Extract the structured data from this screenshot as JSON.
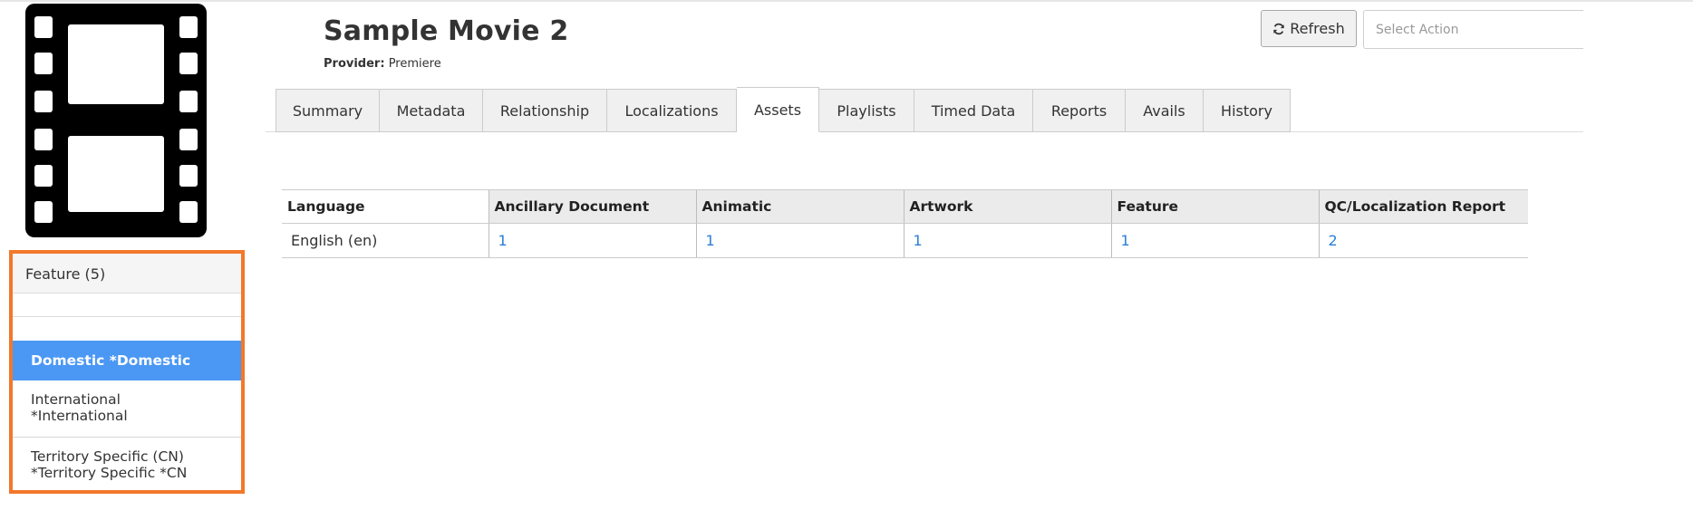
{
  "header": {
    "title": "Sample Movie 2",
    "provider_label": "Provider:",
    "provider_value": "Premiere"
  },
  "toolbar": {
    "refresh_label": "Refresh",
    "select_action_placeholder": "Select Action"
  },
  "tabs": [
    {
      "label": "Summary",
      "active": false
    },
    {
      "label": "Metadata",
      "active": false
    },
    {
      "label": "Relationship",
      "active": false
    },
    {
      "label": "Localizations",
      "active": false
    },
    {
      "label": "Assets",
      "active": true
    },
    {
      "label": "Playlists",
      "active": false
    },
    {
      "label": "Timed Data",
      "active": false
    },
    {
      "label": "Reports",
      "active": false
    },
    {
      "label": "Avails",
      "active": false
    },
    {
      "label": "History",
      "active": false
    }
  ],
  "sidebar": {
    "header": "Feature (5)",
    "items": [
      {
        "line1": "Domestic *Domestic",
        "line2": "",
        "active": true
      },
      {
        "line1": "International",
        "line2": "*International",
        "active": false
      },
      {
        "line1": "Territory Specific (CN)",
        "line2": "*Territory Specific *CN",
        "active": false
      }
    ]
  },
  "assets_table": {
    "columns": [
      "Language",
      "Ancillary Document",
      "Animatic",
      "Artwork",
      "Feature",
      "QC/Localization Report"
    ],
    "rows": [
      [
        "English (en)",
        "1",
        "1",
        "1",
        "1",
        "2"
      ]
    ]
  },
  "colors": {
    "accent_orange": "#f2782b",
    "active_blue": "#4a97f4",
    "link_blue": "#2a7fd4"
  },
  "icons": {
    "poster": "film-strip-icon",
    "refresh": "refresh-icon"
  }
}
